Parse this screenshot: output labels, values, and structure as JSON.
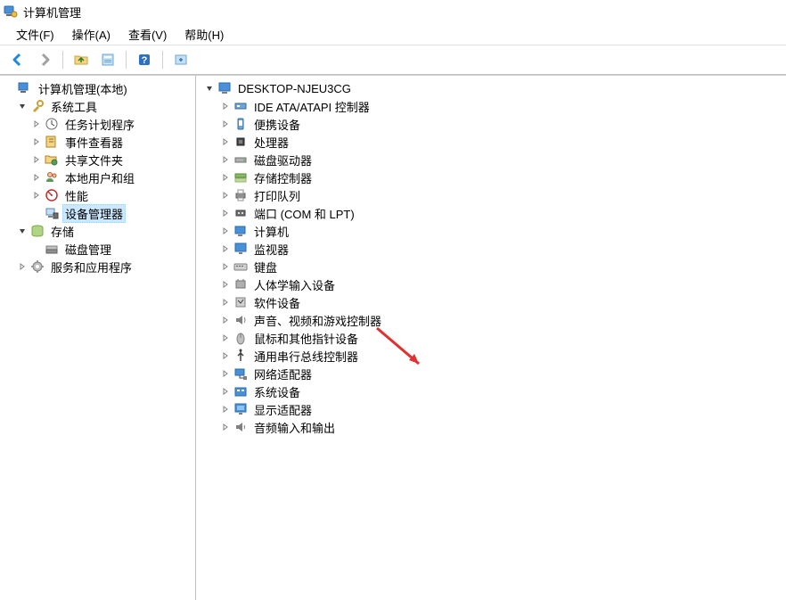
{
  "window": {
    "title": "计算机管理"
  },
  "menus": {
    "file": "文件(F)",
    "action": "操作(A)",
    "view": "查看(V)",
    "help": "帮助(H)"
  },
  "toolbar_icons": {
    "back": "back-icon",
    "forward": "forward-icon",
    "up": "up-folder-icon",
    "props": "properties-icon",
    "help": "help-icon",
    "refresh": "refresh-icon"
  },
  "left_tree": {
    "root": {
      "label": "计算机管理(本地)",
      "expanded": true
    },
    "system_tools": {
      "label": "系统工具",
      "expanded": true
    },
    "task_scheduler": {
      "label": "任务计划程序",
      "expanded": false
    },
    "event_viewer": {
      "label": "事件查看器",
      "expanded": false
    },
    "shared_folders": {
      "label": "共享文件夹",
      "expanded": false
    },
    "local_users": {
      "label": "本地用户和组",
      "expanded": false
    },
    "performance": {
      "label": "性能",
      "expanded": false
    },
    "device_manager": {
      "label": "设备管理器",
      "selected": true
    },
    "storage": {
      "label": "存储",
      "expanded": true
    },
    "disk_management": {
      "label": "磁盘管理"
    },
    "services_apps": {
      "label": "服务和应用程序",
      "expanded": false
    }
  },
  "right_tree": {
    "root": {
      "label": "DESKTOP-NJEU3CG",
      "expanded": true
    },
    "items": [
      {
        "id": "ide",
        "label": "IDE ATA/ATAPI 控制器",
        "icon": "ide-icon"
      },
      {
        "id": "portable",
        "label": "便携设备",
        "icon": "portable-icon"
      },
      {
        "id": "processor",
        "label": "处理器",
        "icon": "cpu-icon"
      },
      {
        "id": "disk",
        "label": "磁盘驱动器",
        "icon": "disk-icon"
      },
      {
        "id": "storage-ctrl",
        "label": "存储控制器",
        "icon": "storage-ctrl-icon"
      },
      {
        "id": "print",
        "label": "打印队列",
        "icon": "printer-icon"
      },
      {
        "id": "ports",
        "label": "端口 (COM 和 LPT)",
        "icon": "port-icon"
      },
      {
        "id": "computer",
        "label": "计算机",
        "icon": "computer-icon"
      },
      {
        "id": "monitor",
        "label": "监视器",
        "icon": "monitor-icon"
      },
      {
        "id": "keyboard",
        "label": "键盘",
        "icon": "keyboard-icon"
      },
      {
        "id": "hid",
        "label": "人体学输入设备",
        "icon": "hid-icon"
      },
      {
        "id": "software",
        "label": "软件设备",
        "icon": "software-icon"
      },
      {
        "id": "sound",
        "label": "声音、视频和游戏控制器",
        "icon": "speaker-icon"
      },
      {
        "id": "mouse",
        "label": "鼠标和其他指针设备",
        "icon": "mouse-icon"
      },
      {
        "id": "usb",
        "label": "通用串行总线控制器",
        "icon": "usb-icon"
      },
      {
        "id": "network",
        "label": "网络适配器",
        "icon": "network-icon"
      },
      {
        "id": "system",
        "label": "系统设备",
        "icon": "system-icon"
      },
      {
        "id": "display",
        "label": "显示适配器",
        "icon": "display-icon"
      },
      {
        "id": "audio",
        "label": "音频输入和输出",
        "icon": "audio-icon"
      }
    ]
  }
}
